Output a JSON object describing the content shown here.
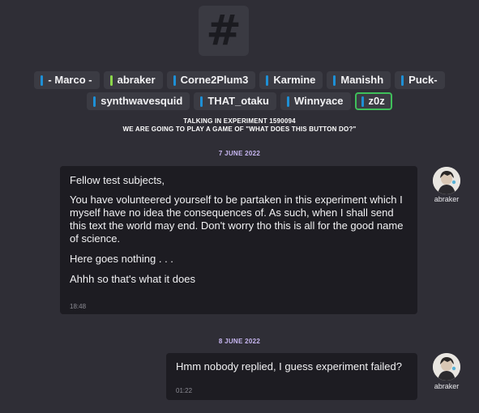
{
  "channel": {
    "icon": "#"
  },
  "members": [
    {
      "name": "- Marco -",
      "color": "#1e90d6",
      "selected": false
    },
    {
      "name": "abraker",
      "color": "#8bd64a",
      "selected": false
    },
    {
      "name": "Corne2Plum3",
      "color": "#1e90d6",
      "selected": false
    },
    {
      "name": "Karmine",
      "color": "#1e90d6",
      "selected": false
    },
    {
      "name": "Manishh",
      "color": "#1e90d6",
      "selected": false
    },
    {
      "name": "Puck-",
      "color": "#1e90d6",
      "selected": false
    },
    {
      "name": "synthwavesquid",
      "color": "#1e90d6",
      "selected": false
    },
    {
      "name": "THAT_otaku",
      "color": "#1e90d6",
      "selected": false
    },
    {
      "name": "Winnyace",
      "color": "#1e90d6",
      "selected": false
    },
    {
      "name": "z0z",
      "color": "#1e90d6",
      "selected": true
    }
  ],
  "topic": {
    "line1": "TALKING IN EXPERIMENT 1590094",
    "line2": "WE ARE GOING TO PLAY A GAME OF \"WHAT DOES THIS BUTTON DO?\""
  },
  "messages": [
    {
      "date": "7 JUNE 2022",
      "author": "abraker",
      "paragraphs": [
        "Fellow test subjects,",
        "You have volunteered yourself to be partaken in this experiment which I myself have no idea the consequences of. As such, when I shall send this text the world may end. Don't worry tho this is all for the good name of science.",
        "Here goes nothing . . .",
        "Ahhh so that's what it does"
      ],
      "time": "18:48"
    },
    {
      "date": "8 JUNE 2022",
      "author": "abraker",
      "paragraphs": [
        "Hmm nobody replied, I guess experiment failed?"
      ],
      "time": "01:22"
    }
  ]
}
